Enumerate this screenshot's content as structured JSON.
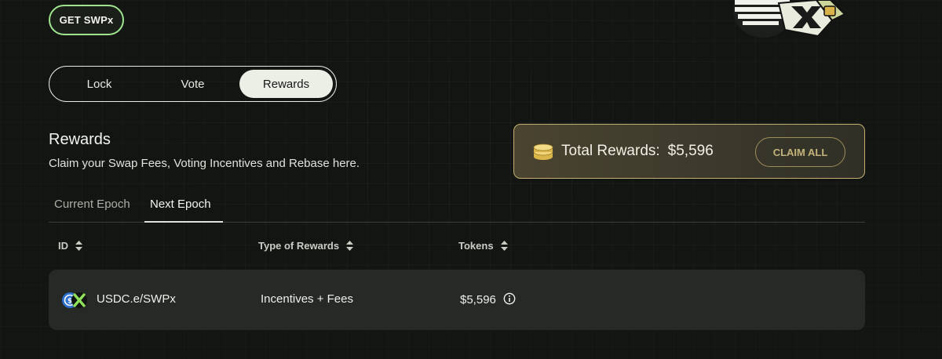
{
  "header": {
    "get_button_label": "GET SWPx"
  },
  "tabs": [
    {
      "label": "Lock",
      "active": false
    },
    {
      "label": "Vote",
      "active": false
    },
    {
      "label": "Rewards",
      "active": true
    }
  ],
  "rewards": {
    "title": "Rewards",
    "subtitle": "Claim your Swap Fees, Voting Incentives and Rebase here."
  },
  "total": {
    "label": "Total Rewards:",
    "value": "$5,596",
    "claim_label": "CLAIM ALL",
    "icon": "coins-icon"
  },
  "epoch_tabs": [
    {
      "label": "Current Epoch",
      "active": false
    },
    {
      "label": "Next Epoch",
      "active": true
    }
  ],
  "table": {
    "columns": [
      "ID",
      "Type of Rewards",
      "Tokens"
    ],
    "rows": [
      {
        "id": "USDC.e/SWPx",
        "type": "Incentives + Fees",
        "tokens": "$5,596"
      }
    ]
  },
  "colors": {
    "accent_green": "#9fe38f",
    "gold": "#c5b071",
    "background": "#121512"
  }
}
